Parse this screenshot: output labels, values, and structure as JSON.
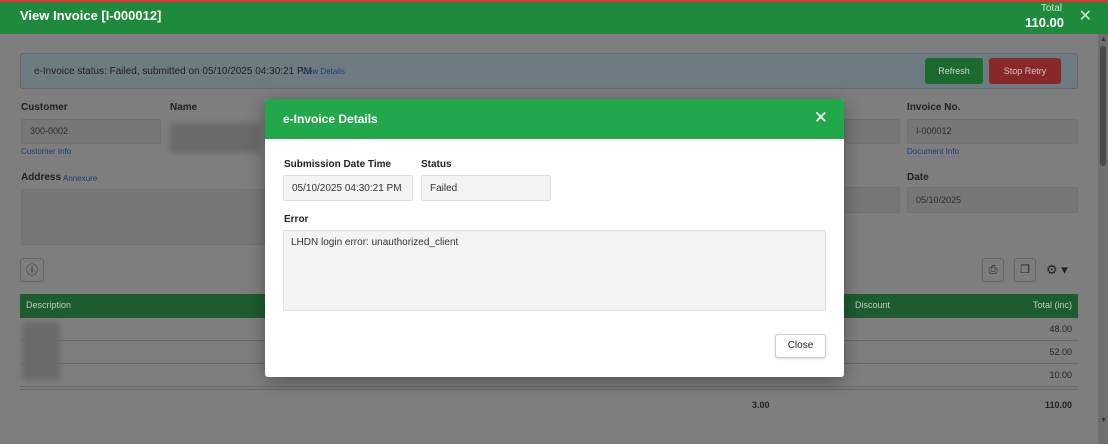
{
  "window": {
    "title": "View Invoice [I-000012]",
    "total_label": "Total",
    "total_value": "110.00",
    "close_glyph": "✕"
  },
  "status_bar": {
    "text": "e-Invoice status: Failed, submitted on 05/10/2025 04:30:21 PM",
    "link": "View Details",
    "refresh_label": "Refresh",
    "stop_retry_label": "Stop Retry"
  },
  "customer": {
    "label": "Customer",
    "value": "300-0002",
    "info_link": "Customer Info"
  },
  "name": {
    "label": "Name"
  },
  "address": {
    "label": "Address",
    "annexure_link": "Annexure"
  },
  "invoice": {
    "label": "Invoice No.",
    "value": "I-000012",
    "doc_link": "Document Info"
  },
  "date": {
    "label": "Date",
    "value": "05/10/2025"
  },
  "icons": {
    "info": "info-circle-icon",
    "pdf": "pdf-icon",
    "copy": "copy-icon",
    "settings": "gear-icon",
    "close": "close-icon"
  },
  "table": {
    "headers": {
      "description": "Description",
      "discount": "Discount",
      "total": "Total (inc)"
    },
    "rows": [
      {
        "total": "48.00"
      },
      {
        "total": "52.00"
      },
      {
        "total": "10.00"
      }
    ],
    "summary": {
      "qty": "3.00",
      "total": "110.00"
    }
  },
  "modal": {
    "title": "e-Invoice Details",
    "submission_label": "Submission Date Time",
    "submission_value": "05/10/2025 04:30:21 PM",
    "status_label": "Status",
    "status_value": "Failed",
    "error_label": "Error",
    "error_value": "LHDN login error: unauthorized_client",
    "close_label": "Close"
  },
  "colors": {
    "header_green": "#1f8a3b",
    "modal_header_green": "#22a74a",
    "danger_red": "#d33"
  }
}
